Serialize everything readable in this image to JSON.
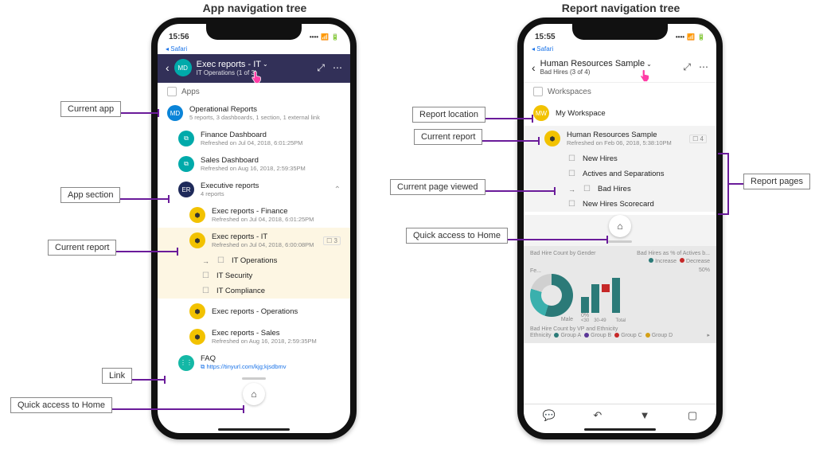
{
  "headings": {
    "left": "App navigation tree",
    "right": "Report navigation tree"
  },
  "status": {
    "time_left": "15:56",
    "time_right": "15:55",
    "breadcrumb": "◂ Safari"
  },
  "left_phone": {
    "header": {
      "avatar": "MD",
      "title": "Exec reports - IT",
      "subtitle": "IT Operations (1 of 3)"
    },
    "apps_label": "Apps",
    "current_app": {
      "title": "Operational Reports",
      "sub": "5 reports, 3 dashboards, 1 section, 1 external link"
    },
    "dash1": {
      "title": "Finance Dashboard",
      "sub": "Refreshed on Jul 04, 2018, 6:01:25PM"
    },
    "dash2": {
      "title": "Sales Dashboard",
      "sub": "Refreshed on Aug 16, 2018, 2:59:35PM"
    },
    "section": {
      "title": "Executive reports",
      "sub": "4 reports"
    },
    "rep1": {
      "title": "Exec reports - Finance",
      "sub": "Refreshed on Jul 04, 2018, 6:01:25PM"
    },
    "rep_current": {
      "title": "Exec reports - IT",
      "sub": "Refreshed on Jul 04, 2018, 6:00:08PM",
      "badge": "3"
    },
    "pages": {
      "p1": "IT Operations",
      "p2": "IT Security",
      "p3": "IT Compliance"
    },
    "rep3": {
      "title": "Exec reports - Operations"
    },
    "rep4": {
      "title": "Exec reports - Sales",
      "sub": "Refreshed on Aug 16, 2018, 2:59:35PM"
    },
    "faq": {
      "title": "FAQ",
      "url": "https://tinyurl.com/kjg;kjsdbmv"
    }
  },
  "right_phone": {
    "header": {
      "title": "Human Resources Sample",
      "subtitle": "Bad Hires (3 of 4)"
    },
    "workspaces_label": "Workspaces",
    "workspace": {
      "avatar": "MW",
      "title": "My Workspace"
    },
    "report": {
      "title": "Human Resources Sample",
      "sub": "Refreshed on Feb 06, 2018, 5:38:10PM",
      "badge": "4"
    },
    "pages": {
      "p1": "New Hires",
      "p2": "Actives and Separations",
      "p3": "Bad Hires",
      "p4": "New Hires Scorecard"
    },
    "charts": {
      "t1": "Bad Hire Count by Gender",
      "t2": "Bad Hires as % of Actives b...",
      "leg_inc": "Increase",
      "leg_dec": "Decrease",
      "lab_fe": "Fe...",
      "lab_male": "Male",
      "pct50": "50%",
      "pct0": "0%",
      "x1": "<30",
      "x2": "30-49",
      "x3": "Total",
      "t3": "Bad Hire Count by VP and Ethnicity",
      "eth": "Ethnicity",
      "ga": "Group A",
      "gb": "Group B",
      "gc": "Group C",
      "gd": "Group D"
    }
  },
  "callouts": {
    "current_app": "Current app",
    "app_section": "App section",
    "current_report": "Current report",
    "link": "Link",
    "home": "Quick access to Home",
    "report_loc": "Report location",
    "current_report_r": "Current report",
    "current_page": "Current page viewed",
    "home_r": "Quick access to Home",
    "report_pages": "Report pages"
  }
}
